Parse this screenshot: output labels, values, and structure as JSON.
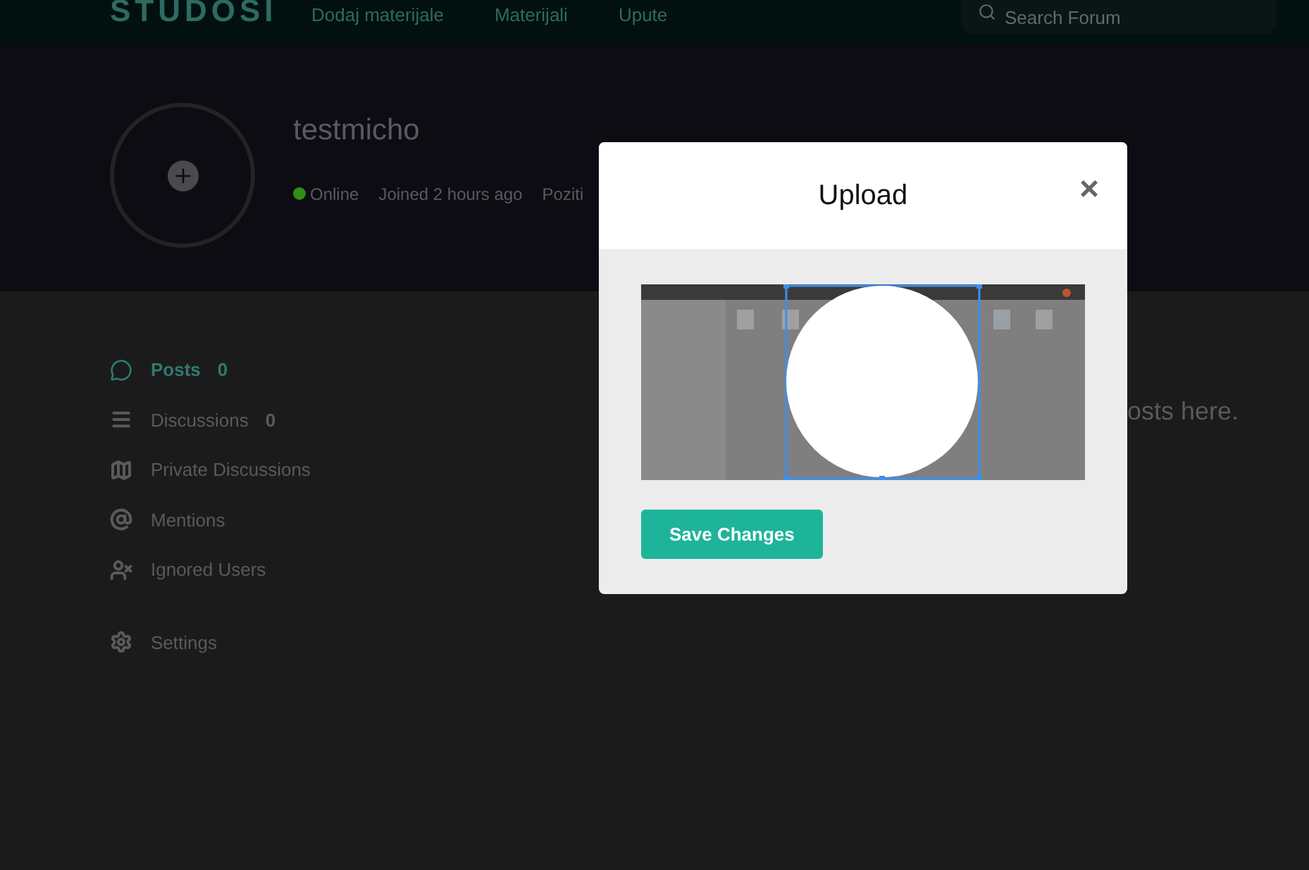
{
  "navbar": {
    "logo": "STUDOSI",
    "links": [
      "Dodaj materijale",
      "Materijali",
      "Upute"
    ],
    "search": {
      "placeholder": "Search Forum"
    }
  },
  "profile": {
    "username": "testmicho",
    "status": {
      "label": "Online",
      "color": "#2f8f14"
    },
    "joined": "Joined 2 hours ago",
    "extra": "Poziti"
  },
  "sidebar": {
    "items": [
      {
        "label": "Posts",
        "count": "0",
        "selected": true
      },
      {
        "label": "Discussions",
        "count": "0",
        "selected": false
      },
      {
        "label": "Private Discussions",
        "selected": false
      },
      {
        "label": "Mentions",
        "selected": false
      },
      {
        "label": "Ignored Users",
        "selected": false
      }
    ],
    "settings": {
      "label": "Settings"
    }
  },
  "content": {
    "empty_text": "osts here."
  },
  "modal": {
    "title": "Upload",
    "close": "×",
    "button": "Save Changes"
  }
}
